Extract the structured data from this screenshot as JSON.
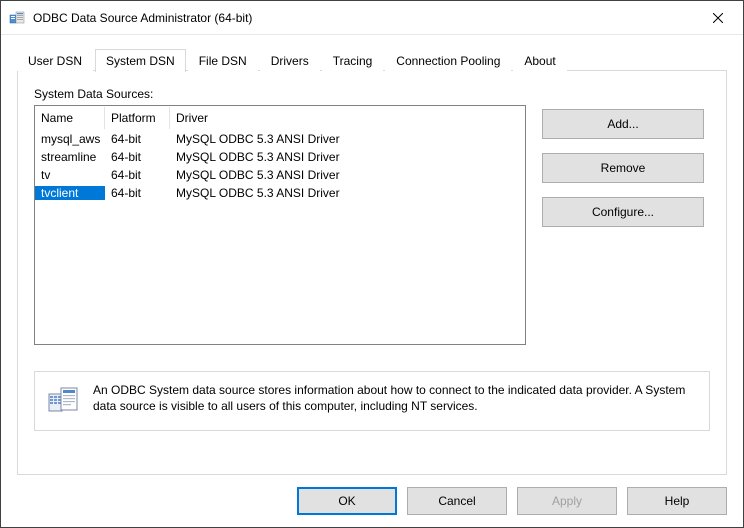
{
  "titlebar": {
    "title": "ODBC Data Source Administrator (64-bit)"
  },
  "tabs": [
    {
      "label": "User DSN"
    },
    {
      "label": "System DSN"
    },
    {
      "label": "File DSN"
    },
    {
      "label": "Drivers"
    },
    {
      "label": "Tracing"
    },
    {
      "label": "Connection Pooling"
    },
    {
      "label": "About"
    }
  ],
  "active_tab_index": 1,
  "panel": {
    "label": "System Data Sources:",
    "columns": [
      "Name",
      "Platform",
      "Driver"
    ],
    "rows": [
      {
        "name": "mysql_aws",
        "platform": "64-bit",
        "driver": "MySQL ODBC 5.3 ANSI Driver"
      },
      {
        "name": "streamline",
        "platform": "64-bit",
        "driver": "MySQL ODBC 5.3 ANSI Driver"
      },
      {
        "name": "tv",
        "platform": "64-bit",
        "driver": "MySQL ODBC 5.3 ANSI Driver"
      },
      {
        "name": "tvclient",
        "platform": "64-bit",
        "driver": "MySQL ODBC 5.3 ANSI Driver"
      }
    ],
    "selected_row_index": 3,
    "buttons": {
      "add": "Add...",
      "remove": "Remove",
      "configure": "Configure..."
    },
    "info": "An ODBC System data source stores information about how to connect to the indicated data provider. A System data source is visible to all users of this computer, including NT services."
  },
  "footer": {
    "ok": "OK",
    "cancel": "Cancel",
    "apply": "Apply",
    "help": "Help"
  }
}
